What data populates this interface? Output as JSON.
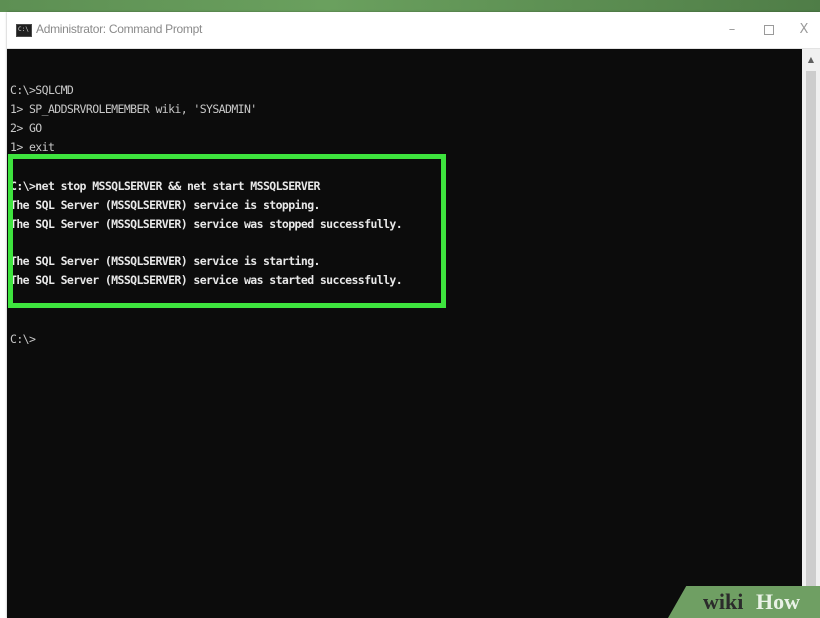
{
  "window": {
    "title": "Administrator: Command Prompt",
    "app_icon_glyph": "C:\\",
    "minimize_glyph": "–",
    "close_glyph": "X"
  },
  "console": {
    "lines": [
      "C:\\>SQLCMD",
      "1> SP_ADDSRVROLEMEMBER wiki, 'SYSADMIN'",
      "2> GO",
      "1> exit",
      "C:\\>net stop MSSQLSERVER && net start MSSQLSERVER",
      "The SQL Server (MSSQLSERVER) service is stopping.",
      "The SQL Server (MSSQLSERVER) service was stopped successfully.",
      "The SQL Server (MSSQLSERVER) service is starting.",
      "The SQL Server (MSSQLSERVER) service was started successfully.",
      "C:\\>"
    ]
  },
  "scrollbar": {
    "up_arrow_glyph": "▲"
  },
  "watermark": {
    "wiki": "wiki",
    "how": "How"
  },
  "colors": {
    "console_background": "#0c0c0c",
    "console_text": "#c8c8c8",
    "highlight_border": "#3ee43e",
    "watermark_background": "#6f9f63"
  }
}
